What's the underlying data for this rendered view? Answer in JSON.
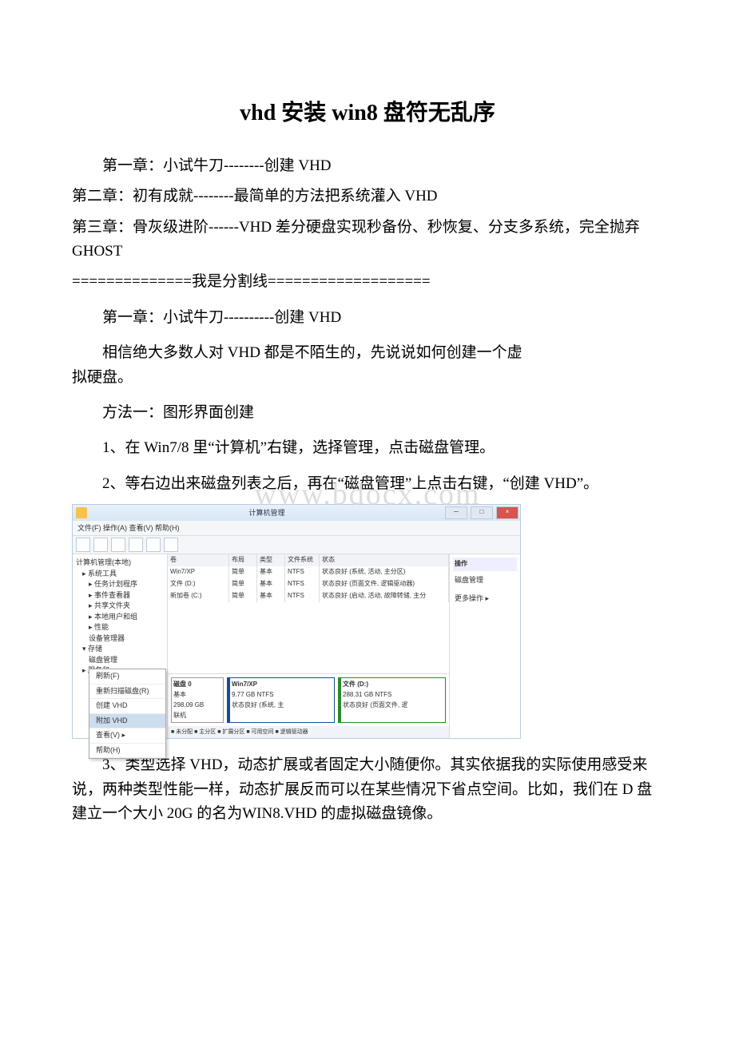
{
  "title": "vhd 安装 win8 盘符无乱序",
  "toc": {
    "ch1": "第一章：小试牛刀--------创建 VHD",
    "ch2": "第二章：初有成就--------最简单的方法把系统灌入 VHD",
    "ch3": "第三章：骨灰级进阶------VHD 差分硬盘实现秒备份、秒恢复、分支多系统，完全抛弃 GHOST",
    "sep": "==============我是分割线==================="
  },
  "body": {
    "p1": "第一章：小试牛刀----------创建 VHD",
    "p2": "相信绝大多数人对 VHD 都是不陌生的，先说说如何创建一个虚拟硬盘。",
    "p3": "方法一：图形界面创建",
    "p4": "1、在 Win7/8 里“计算机”右键，选择管理，点击磁盘管理。",
    "p5": "2、等右边出来磁盘列表之后，再在“磁盘管理”上点击右键，“创建 VHD”。",
    "p6": "3、类型选择 VHD，动态扩展或者固定大小随便你。其实依据我的实际使用感受来说，两种类型性能一样，动态扩展反而可以在某些情况下省点空间。比如，我们在 D 盘建立一个大小 20G 的名为WIN8.VHD 的虚拟磁盘镜像。"
  },
  "watermark": "www.bdocx.com",
  "ss": {
    "title": "计算机管理",
    "menu": "文件(F)  操作(A)  查看(V)  帮助(H)",
    "root": "计算机管理(本地)",
    "tree": {
      "t1": "系统工具",
      "t2": "任务计划程序",
      "t3": "事件查看器",
      "t4": "共享文件夹",
      "t5": "本地用户和组",
      "t6": "性能",
      "t7": "设备管理器",
      "t8": "存储",
      "t9": "磁盘管理",
      "t10": "服务和"
    },
    "ctx": {
      "m1": "刷新(F)",
      "m2": "重新扫描磁盘(R)",
      "m3": "创建 VHD",
      "m4": "附加 VHD",
      "m5": "查看(V)",
      "m6": "帮助(H)"
    },
    "hdr": {
      "h1": "卷",
      "h2": "布局",
      "h3": "类型",
      "h4": "文件系统",
      "h5": "状态"
    },
    "rows": [
      {
        "v": "Win7/XP",
        "l": "简单",
        "t": "基本",
        "fs": "NTFS",
        "s": "状态良好 (系统, 活动, 主分区)"
      },
      {
        "v": "文件 (D:)",
        "l": "简单",
        "t": "基本",
        "fs": "NTFS",
        "s": "状态良好 (页面文件, 逻辑驱动器)"
      },
      {
        "v": "新加卷 (C:)",
        "l": "简单",
        "t": "基本",
        "fs": "NTFS",
        "s": "状态良好 (启动, 活动, 故障转储, 主分"
      }
    ],
    "disk": {
      "lbl": "磁盘 0",
      "type": "基本",
      "size": "298.09 GB",
      "stat": "联机",
      "p1n": "Win7/XP",
      "p1s": "9.77 GB NTFS",
      "p1st": "状态良好 (系统, 主",
      "p2n": "文件 (D:)",
      "p2s": "288.31 GB NTFS",
      "p2st": "状态良好 (页面文件, 逻"
    },
    "legend": "■ 未分配 ■ 主分区 ■ 扩展分区 ■ 可用空间 ■ 逻辑驱动器",
    "side": {
      "hd": "操作",
      "l1": "磁盘管理",
      "l2": "更多操作"
    }
  }
}
